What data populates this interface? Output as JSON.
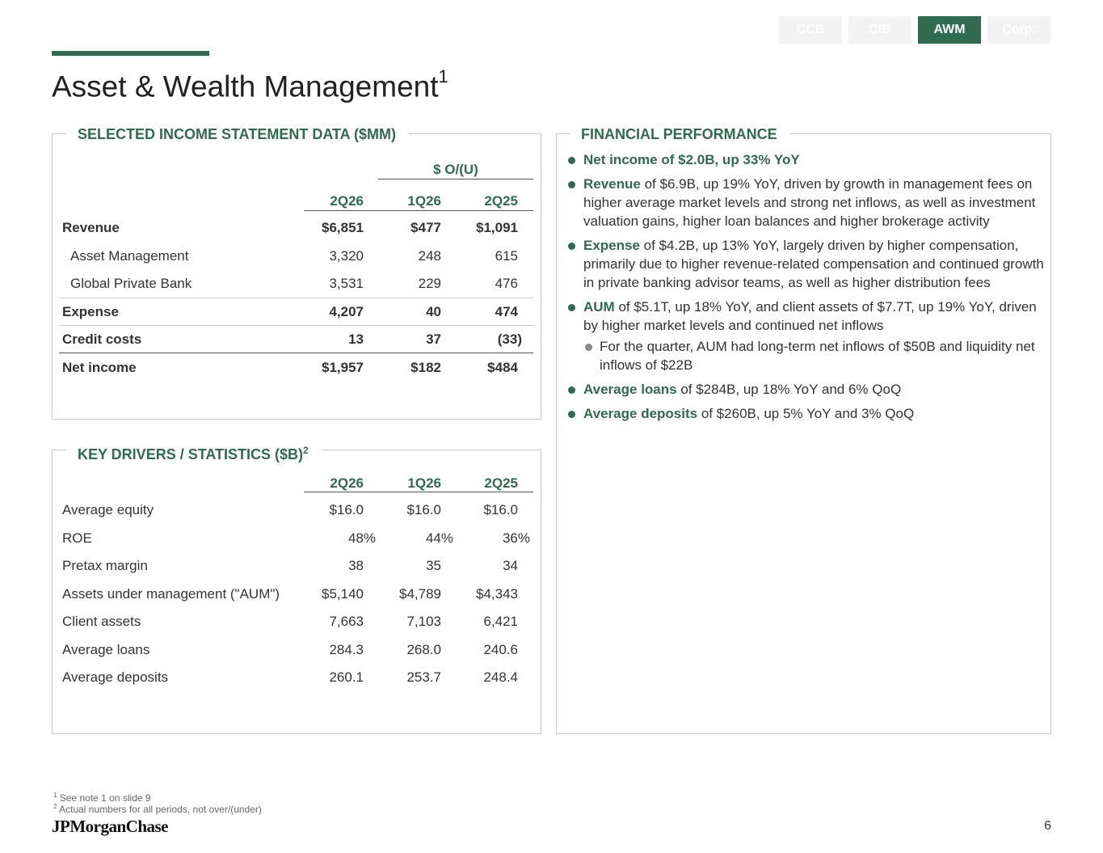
{
  "tabs": [
    {
      "label": "CCB",
      "active": false
    },
    {
      "label": "CIB",
      "active": false
    },
    {
      "label": "AWM",
      "active": true
    },
    {
      "label": "Corp.",
      "active": false
    }
  ],
  "title": {
    "text": "Asset & Wealth Management",
    "note": "1"
  },
  "income": {
    "heading": "SELECTED INCOME STATEMENT DATA ($MM)",
    "group_label": "$ O/(U)",
    "columns": [
      "2Q26",
      "1Q26",
      "2Q25"
    ],
    "rows": [
      {
        "label": "Revenue",
        "values": [
          "$6,851",
          "$477",
          "$1,091"
        ]
      },
      {
        "label": "Asset Management",
        "values": [
          "3,320",
          "248",
          "615"
        ]
      },
      {
        "label": "Global Private Bank",
        "values": [
          "3,531",
          "229",
          "476"
        ]
      },
      {
        "label": "Expense",
        "values": [
          "4,207",
          "40",
          "474"
        ]
      },
      {
        "label": "Credit costs",
        "values": [
          "13",
          "37",
          "(33)"
        ]
      },
      {
        "label": "Net income",
        "values": [
          "$1,957",
          "$182",
          "$484"
        ]
      }
    ]
  },
  "drivers": {
    "heading": "KEY DRIVERS / STATISTICS ($B)",
    "note": "2",
    "columns": [
      "2Q26",
      "1Q26",
      "2Q25"
    ],
    "rows": [
      {
        "label": "Average equity",
        "values": [
          "$16.0",
          "$16.0",
          "$16.0"
        ]
      },
      {
        "label": "ROE",
        "values": [
          "48%",
          "44%",
          "36%"
        ]
      },
      {
        "label": "Pretax margin",
        "values": [
          "38",
          "35",
          "34"
        ]
      },
      {
        "label": "Assets under management (\"AUM\")",
        "values": [
          "$5,140",
          "$4,789",
          "$4,343"
        ]
      },
      {
        "label": "Client assets",
        "values": [
          "7,663",
          "7,103",
          "6,421"
        ]
      },
      {
        "label": "Average loans",
        "values": [
          "284.3",
          "268.0",
          "240.6"
        ]
      },
      {
        "label": "Average deposits",
        "values": [
          "260.1",
          "253.7",
          "248.4"
        ]
      }
    ]
  },
  "performance": {
    "heading": "FINANCIAL PERFORMANCE",
    "bullets": [
      {
        "lead": "Net income of $2.0B, up 33% YoY",
        "text": "",
        "sub": false
      },
      {
        "lead": "Revenue",
        "text": " of $6.9B, up 19% YoY, driven by growth in management fees on higher average market levels and strong net inflows, as well as investment valuation gains, higher loan balances and higher brokerage activity",
        "sub": false
      },
      {
        "lead": "Expense",
        "text": " of $4.2B, up 13% YoY, largely driven by higher compensation, primarily due to higher revenue-related compensation and continued growth in private banking advisor teams, as well as higher distribution fees",
        "sub": false
      },
      {
        "lead": "AUM",
        "text": " of $5.1T, up 18% YoY, and client assets of $7.7T, up 19% YoY, driven by higher market levels and continued net inflows",
        "sub": false
      },
      {
        "lead": "",
        "text": "For the quarter, AUM had long-term net inflows of $50B and liquidity net inflows of $22B",
        "sub": true
      },
      {
        "lead": "Average loans",
        "text": " of $284B, up 18% YoY and 6% QoQ",
        "sub": false
      },
      {
        "lead": "Average deposits",
        "text": " of $260B, up 5% YoY and 3% QoQ",
        "sub": false
      }
    ]
  },
  "footnotes": [
    {
      "num": "1",
      "text": "See note 1 on slide 9"
    },
    {
      "num": "2",
      "text": "Actual numbers for all periods, not over/(under)"
    }
  ],
  "logo": "JPMorganChase",
  "page_number": "6",
  "colors": {
    "accent": "#2f6b4f",
    "tab_inactive": "#f2f2f2",
    "border": "#c8c8c8"
  }
}
